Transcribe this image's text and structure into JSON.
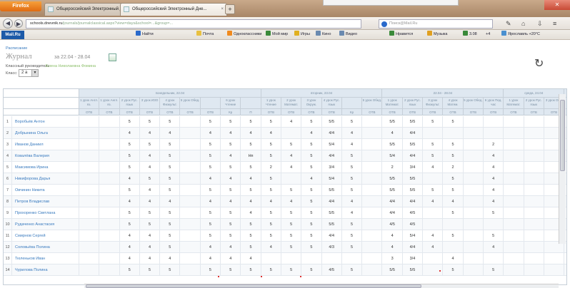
{
  "browser": {
    "menu_button": "Firefox",
    "tabs": [
      {
        "title": "Общероссийский Электронный Дне..."
      },
      {
        "title": "Общероссийский Электронный Дне..."
      }
    ],
    "new_tab": "+",
    "url_prefix": "schools.dnevnik.ru",
    "url": "/journals/journalclassical.aspx?view=days&school=...&group=...",
    "search_placeholder": "Поиск@Mail.Ru",
    "bookmarks": {
      "site": "Mail.Ru",
      "items": [
        "Найти",
        "Почта",
        "Одноклассники",
        "Мой мир",
        "Игры",
        "Кино",
        "Видео",
        "Нравится",
        "Музыка",
        "3.08",
        "+4",
        "Ярославль +20°C"
      ]
    }
  },
  "page": {
    "breadcrumb": "Расписание",
    "title": "Журнал",
    "date_range": "за 22.04 - 28.04",
    "teacher_label": "Классный руководитель:",
    "teacher_name": "Елена Николаевна Фомина",
    "class_label": "Класс:",
    "class_value": "2 а"
  },
  "journal": {
    "group_headers": [
      "понедельник, 22.04",
      "вторник, 23.04",
      "22.04 - 28.04",
      "среда, 24.04"
    ],
    "subject_headers": [
      "1 урок Англ. яз.",
      "1 урок Англ. яз.",
      "2 урок Рус. язык",
      "3 урок ИЗО",
      "4 урок Физкульт.",
      "5 урок Обед.",
      "",
      "6 урок Чтение",
      "",
      "1 урок Чтение",
      "2 урок Математ.",
      "3 урок Окруж.",
      "4 урок Рус. язык",
      "",
      "5 урок Обед.",
      "1 урок Математ.",
      "2 урок Рус. язык",
      "3 урок Физкульт.",
      "4 урок Матем.",
      "5 урок Обед.",
      "6 урок Пед. час",
      "1 урок Математ.",
      "2 урок Рус. язык",
      "3 урок Ок..."
    ],
    "type_headers": [
      "ОТВ",
      "ОТВ",
      "ОТВ",
      "ОТВ",
      "ОТВ",
      "ОТВ",
      "ОТВ",
      "Кр",
      "П",
      "ОТВ",
      "ОТВ",
      "ОТВ",
      "ОТВ",
      "Кр",
      "ОТВ",
      "ОТВ",
      "ОТВ",
      "ОТВ",
      "ОТВ",
      "ОТВ",
      "ОТВ",
      "ОТВ",
      "ОТВ",
      "ОТВ"
    ],
    "rows": [
      {
        "n": "1",
        "name": "Воробьёв Антон",
        "marks": [
          "",
          "",
          "5",
          "5",
          "5",
          "",
          "5",
          "5",
          "5",
          "5",
          "4",
          "5",
          "5/5",
          "5",
          "",
          "5/5",
          "5/5",
          "5",
          "5",
          "",
          "",
          "",
          "",
          ""
        ]
      },
      {
        "n": "2",
        "name": "Добрынина Ольга",
        "marks": [
          "",
          "",
          "4",
          "4",
          "4",
          "",
          "4",
          "4",
          "4",
          "4",
          "",
          "4",
          "4/4",
          "4",
          "",
          "4",
          "4/4",
          "",
          "",
          "",
          "",
          "",
          "",
          ""
        ]
      },
      {
        "n": "3",
        "name": "Иванов Даниил",
        "marks": [
          "",
          "",
          "5",
          "5",
          "5",
          "",
          "5",
          "5",
          "5",
          "5",
          "5",
          "5",
          "5/4",
          "4",
          "",
          "5/5",
          "5/5",
          "5",
          "5",
          "",
          "2",
          "",
          "",
          ""
        ]
      },
      {
        "n": "4",
        "name": "Ковалёва Валерия",
        "marks": [
          "",
          "",
          "5",
          "4",
          "5",
          "",
          "5",
          "4",
          "Нп",
          "5",
          "4",
          "5",
          "4/4",
          "5",
          "",
          "5/4",
          "4/4",
          "5",
          "5",
          "",
          "4",
          "",
          "",
          ""
        ]
      },
      {
        "n": "5",
        "name": "Максимова Ирина",
        "marks": [
          "",
          "",
          "5",
          "4",
          "5",
          "",
          "5",
          "5",
          "5",
          "2",
          "4",
          "5",
          "3/4",
          "5",
          "",
          "2",
          "3/4",
          "4",
          "2",
          "",
          "4",
          "",
          "",
          ""
        ]
      },
      {
        "n": "6",
        "name": "Никифорова Дарья",
        "marks": [
          "",
          "",
          "4",
          "5",
          "5",
          "",
          "4",
          "4",
          "4",
          "5",
          "",
          "4",
          "5/4",
          "5",
          "",
          "5/5",
          "5/5",
          "",
          "5",
          "",
          "4",
          "",
          "",
          ""
        ]
      },
      {
        "n": "7",
        "name": "Овчинин Никита",
        "marks": [
          "",
          "",
          "5",
          "4",
          "5",
          "",
          "5",
          "5",
          "5",
          "5",
          "5",
          "5",
          "5/5",
          "5",
          "",
          "5/5",
          "5/5",
          "5",
          "5",
          "",
          "4",
          "",
          "",
          ""
        ]
      },
      {
        "n": "8",
        "name": "Петров Владислав",
        "marks": [
          "",
          "",
          "4",
          "4",
          "4",
          "",
          "4",
          "4",
          "4",
          "4",
          "4",
          "5",
          "4/4",
          "4",
          "",
          "4/4",
          "4/4",
          "4",
          "4",
          "",
          "4",
          "",
          "",
          ""
        ]
      },
      {
        "n": "9",
        "name": "Прохоренко Светлана",
        "marks": [
          "",
          "",
          "5",
          "5",
          "5",
          "",
          "5",
          "5",
          "4",
          "5",
          "5",
          "5",
          "5/5",
          "4",
          "",
          "4/4",
          "4/5",
          "",
          "5",
          "",
          "5",
          "",
          "",
          ""
        ]
      },
      {
        "n": "10",
        "name": "Рудаченко Анастасия",
        "marks": [
          "",
          "",
          "5",
          "5",
          "5",
          "",
          "5",
          "5",
          "5",
          "5",
          "5",
          "5",
          "5/5",
          "5",
          "",
          "4/5",
          "4/5",
          "",
          "",
          "",
          "",
          "",
          "",
          ""
        ]
      },
      {
        "n": "11",
        "name": "Смирнов Сергей",
        "marks": [
          "",
          "",
          "4",
          "4",
          "5",
          "",
          "5",
          "5",
          "5",
          "5",
          "5",
          "5",
          "4/4",
          "5",
          "",
          "4",
          "5/4",
          "4",
          "5",
          "",
          "5",
          "",
          "",
          ""
        ]
      },
      {
        "n": "12",
        "name": "Соловьёва Полина",
        "marks": [
          "",
          "",
          "4",
          "4",
          "5",
          "",
          "4",
          "4",
          "5",
          "4",
          "5",
          "5",
          "4/3",
          "5",
          "",
          "4",
          "4/4",
          "4",
          "",
          "",
          "4",
          "",
          "",
          ""
        ]
      },
      {
        "n": "13",
        "name": "Тюленьков Иван",
        "marks": [
          "",
          "",
          "4",
          "4",
          "4",
          "",
          "4",
          "4",
          "4",
          "",
          "",
          "",
          "",
          "",
          "",
          "3",
          "3/4",
          "",
          "4",
          "",
          "",
          "",
          "",
          ""
        ]
      },
      {
        "n": "14",
        "name": "Чурилова Полина",
        "marks": [
          "",
          "",
          "5",
          "5",
          "5",
          "",
          "5",
          "5",
          "5",
          "5",
          "5",
          "5",
          "4/5",
          "5",
          "",
          "5/5",
          "5/5",
          "",
          "5",
          "",
          "5",
          "",
          "",
          ""
        ]
      }
    ]
  }
}
